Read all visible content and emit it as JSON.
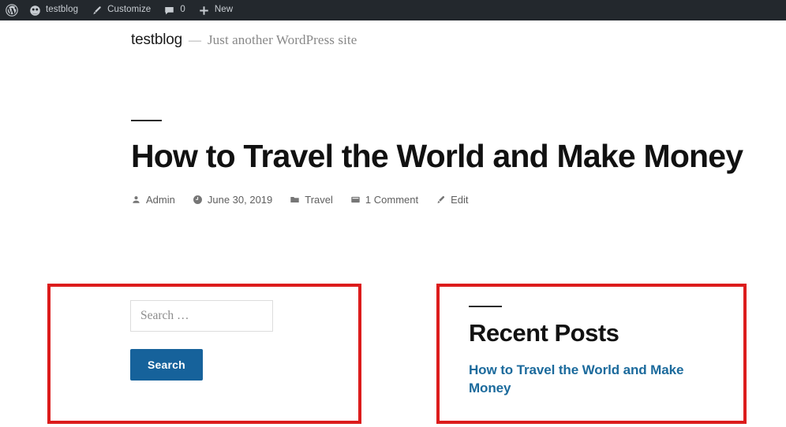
{
  "adminbar": {
    "background": "#23282d",
    "items": [
      {
        "icon": "wordpress-logo-icon",
        "label": ""
      },
      {
        "icon": "site-home-icon",
        "label": "testblog"
      },
      {
        "icon": "paintbrush-icon",
        "label": "Customize"
      },
      {
        "icon": "comment-bubble-icon",
        "label": "0"
      },
      {
        "icon": "plus-icon",
        "label": "New"
      }
    ]
  },
  "site": {
    "title": "testblog",
    "separator": "—",
    "description": "Just another WordPress site"
  },
  "post": {
    "title": "How to Travel the World and Make Money",
    "meta": [
      {
        "icon": "author-person-icon",
        "label": "Admin"
      },
      {
        "icon": "clock-icon",
        "label": "June 30, 2019"
      },
      {
        "icon": "folder-icon",
        "label": "Travel"
      },
      {
        "icon": "comment-icon",
        "label": "1 Comment"
      },
      {
        "icon": "pencil-edit-icon",
        "label": "Edit"
      }
    ]
  },
  "search_widget": {
    "placeholder": "Search …",
    "value": "",
    "submit_label": "Search",
    "submit_color": "#16629b"
  },
  "recent_posts_widget": {
    "heading": "Recent Posts",
    "items": [
      {
        "label": "How to Travel the World and Make Money"
      }
    ],
    "link_color": "#1b6a9c"
  },
  "annotations": {
    "color": "#dc1c1c",
    "boxes": [
      {
        "name": "search-widget-highlight"
      },
      {
        "name": "recent-posts-highlight"
      }
    ]
  }
}
